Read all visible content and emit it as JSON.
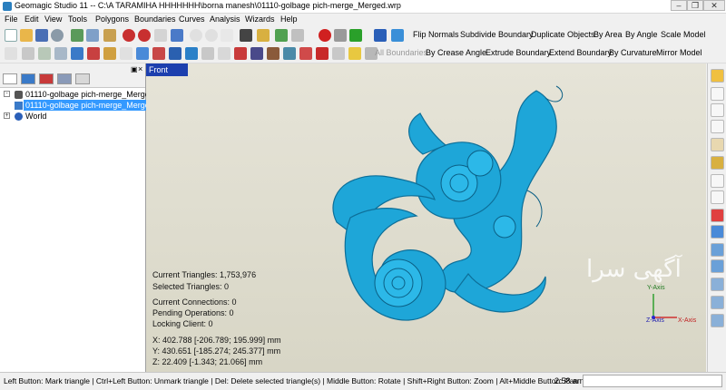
{
  "window": {
    "title": "Geomagic Studio 11 -- C:\\A TARAMIHA HHHHHHH\\borna manesh\\01110-golbage pich-merge_Merged.wrp",
    "minimize_glyph": "–",
    "restore_glyph": "❐",
    "close_glyph": "✕"
  },
  "menu": [
    "File",
    "Edit",
    "View",
    "Tools",
    "Polygons",
    "Boundaries",
    "Curves",
    "Analysis",
    "Wizards",
    "Help"
  ],
  "toolbar1": {
    "commands": [
      "Flip Normals",
      "Subdivide Boundary",
      "Duplicate Objects",
      "By Area",
      "By Angle",
      "Scale Model"
    ]
  },
  "toolbar2": {
    "all_boundaries": "All Boundaries",
    "commands": [
      "By Crease Angle",
      "Extrude Boundary",
      "Extend Boundary",
      "By Curvature",
      "Mirror Model"
    ]
  },
  "tree": {
    "items": [
      {
        "label": "01110-golbage pich-merge_Merged",
        "selected": false
      },
      {
        "label": "01110-golbage pich-merge_Merged",
        "selected": true
      },
      {
        "label": "World",
        "selected": false
      }
    ]
  },
  "viewport": {
    "view_name": "Front",
    "stats": {
      "current_triangles": "Current Triangles: 1,753,976",
      "selected_triangles": "Selected Triangles: 0",
      "current_connections": "Current Connections: 0",
      "pending_operations": "Pending Operations: 0",
      "locking_client": "Locking Client: 0",
      "x": "X: 402.788 [-206.789; 195.999] mm",
      "y": "Y: 430.651 [-185.274; 245.377] mm",
      "z": "Z: 22.409 [-1.343; 21.066] mm"
    },
    "watermark": "آگهی سرا",
    "axes": {
      "y": "Y-Axis",
      "x": "X-Axis",
      "z": "Z-Axis"
    },
    "model_color": "#1ea6d8"
  },
  "status": {
    "message": "Left Button: Mark triangle | Ctrl+Left Button: Unmark triangle | Del: Delete selected triangle(s) | Middle Button: Rotate | Shift+Right Button: Zoom | Alt+Middle Button: Pan",
    "time": "2:58 am"
  }
}
